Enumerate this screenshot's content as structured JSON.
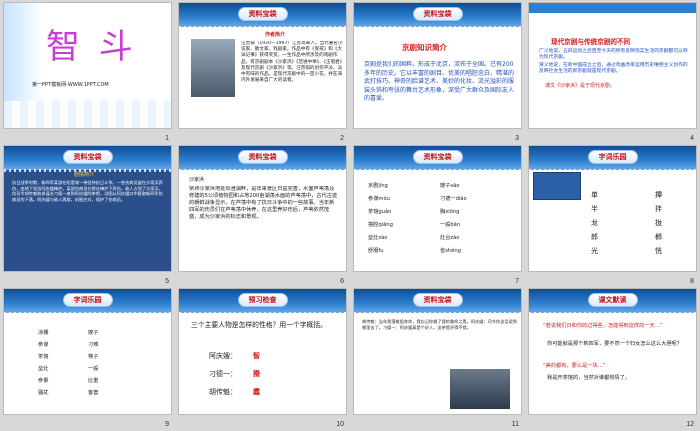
{
  "slides": {
    "s1": {
      "title": "智 斗",
      "subtitle": "第一PPT模板网-WWW.1PPT.COM",
      "num": "1"
    },
    "s2": {
      "badge": "资料宝袋",
      "heading": "作者简介",
      "body": "汪曾祺（1920—1997）江苏高邮人，当代著名小说家、散文家、戏剧家。作品中有《受戒》和《大淖记事》获得奖赏。一生作品中所涉及的戏剧作品，有京剧剧本《沙家浜》《范进中举》、《王昭君》及现代京剧《沙家浜》等。汪曾祺的创作平淡、淡中有味的作品。是现代京剧中的一首小花，并在海内外发展来自广大的读者。",
      "num": "2"
    },
    "s3": {
      "badge": "资料宝袋",
      "heading": "京剧知识简介",
      "body": "京剧是我们的国粹。形成于北京，流布于全国。已有200多年的历史。它以丰富的剧目、优美的唱腔念白、精湛的武打技巧、神奇的脸谱艺术、美妙的化妆、流光溢彩的服装头饰和夸张的舞台艺术形象，深受广大群众及国际友人的喜爱。",
      "num": "3"
    },
    "s4": {
      "heading": "现代京剧与传统京剧的不同",
      "body1": "广义地说，五四运动之后直至今天的所有反映现实生活的京剧都可以称为现代京剧。",
      "body2": "狭义地说，在新中国成立之后，通过戏曲改革运用历史唯物主义创作的反映社会生活的新京剧就是现代京剧。",
      "body3": "课文《沙家浜》是于现代京剧。",
      "num": "4"
    },
    "s5": {
      "badge": "资料宝袋",
      "heading": "剧情简介",
      "body": "抗日战争时期，新四军某部在阳澄湖一带坚持抗日斗争。一些伤病员留在沙家浜养伤，由地下党员阿庆嫂掩护。某部伤病员在群众掩护下养伤。敌人占领了沙家浜，伪司令胡传魁和参谋长刁德一来到阿庆嫂的茶馆，试图从阿庆嫂口中套取新四军伤病员的下落。阿庆嫂与敌人周旋，机智应对，保护了伤病员。",
      "num": "5"
    },
    "s6": {
      "badge": "资料宝袋",
      "heading": "沙家浜",
      "body": "常熟沙家浜地处阳澄湖畔，是年来景区日益完善，水面芦苇荡及修建的5公顷植物园和占地200亩湖荡水面的芦苇荡中，古代古迹的朝鲜战争显示，在芦荡中有了抗日斗争中的一些故事。当年新四军的伤员们在芦苇荡中休养，在这里养好伤后，芦苇依然茂盛，成为沙家浜的标志和景观。",
      "num": "6"
    },
    "s7": {
      "badge": "资料宝袋",
      "rows": [
        [
          "京剧",
          "jīng",
          "嫂子",
          "sǎo"
        ],
        [
          "参谋",
          "móu",
          "刁德一",
          "diāo"
        ],
        [
          "茶馆",
          "guǎn",
          "胸",
          "xiōng"
        ],
        [
          "搭腔",
          "qiāng",
          "一般",
          "bān"
        ],
        [
          "垒灶",
          "zào",
          "灶台",
          "zào"
        ],
        [
          "舒服",
          "fu",
          "省",
          "shěng"
        ]
      ],
      "num": "7"
    },
    "s8": {
      "badge": "字词乐园",
      "left": [
        "单",
        "半",
        "龙",
        "郎",
        "光"
      ],
      "right": [
        "撢",
        "拌",
        "拢",
        "榔",
        "恍"
      ],
      "num": "8"
    },
    "s9": {
      "badge": "字词乐园",
      "rows": [
        [
          "凉棚",
          "嫂子"
        ],
        [
          "参谋",
          "刁难"
        ],
        [
          "茶馆",
          "筷子"
        ],
        [
          "垒灶",
          "一般"
        ],
        [
          "参量",
          "比重"
        ],
        [
          "骚扰",
          "客套"
        ]
      ],
      "num": "9"
    },
    "s10": {
      "badge": "预习检查",
      "question": "三个主要人物是怎样的性格？用一个字概括。",
      "lines": [
        [
          "阿庆嫂：",
          "智"
        ],
        [
          "刁德一：",
          "猾"
        ],
        [
          "胡传魁：",
          "蠢"
        ]
      ],
      "num": "10"
    },
    "s11": {
      "badge": "资料宝袋",
      "body": "胡传魁：当年我落难投奔你，我忘记你救了我的救命之恩。阿庆嫂：司令你这话说到哪里去了。刁德一：阿庆嫂真是个好人，这茶馆开得不错。",
      "num": "11"
    },
    "s12": {
      "badge": "课文默读",
      "lines": [
        "“若说我们日和你的过得些，怎能得到这样的一天…”",
        "你可能就是那个新四军，要不然一个妇女怎么这么大胆呢？",
        "“美的都有，要么是一块…”",
        "我是开茶馆的，当然对谁都热情了。"
      ],
      "num": "12"
    }
  }
}
